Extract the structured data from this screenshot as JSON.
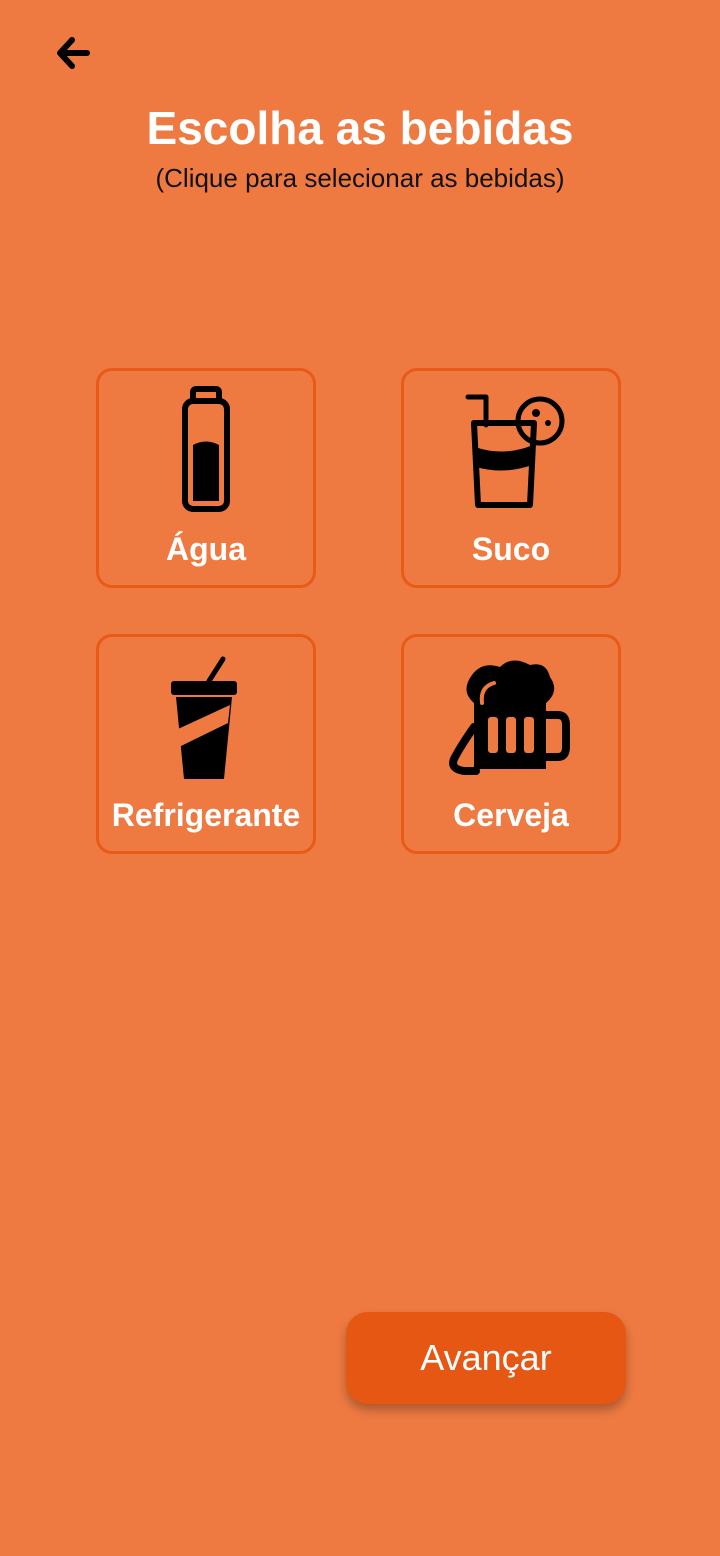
{
  "header": {
    "back_icon": "arrow-left-icon",
    "title": "Escolha as bebidas",
    "subtitle": "(Clique para selecionar as bebidas)"
  },
  "drinks": [
    {
      "label": "Água",
      "icon": "water-bottle-icon"
    },
    {
      "label": "Suco",
      "icon": "juice-glass-icon"
    },
    {
      "label": "Refrigerante",
      "icon": "soda-cup-icon"
    },
    {
      "label": "Cerveja",
      "icon": "beer-mug-icon"
    }
  ],
  "footer": {
    "advance_label": "Avançar"
  },
  "colors": {
    "background": "#EE7A42",
    "tile_border": "#E85A1A",
    "button": "#E55712",
    "text_light": "#FFFFFF",
    "icon": "#000000"
  }
}
